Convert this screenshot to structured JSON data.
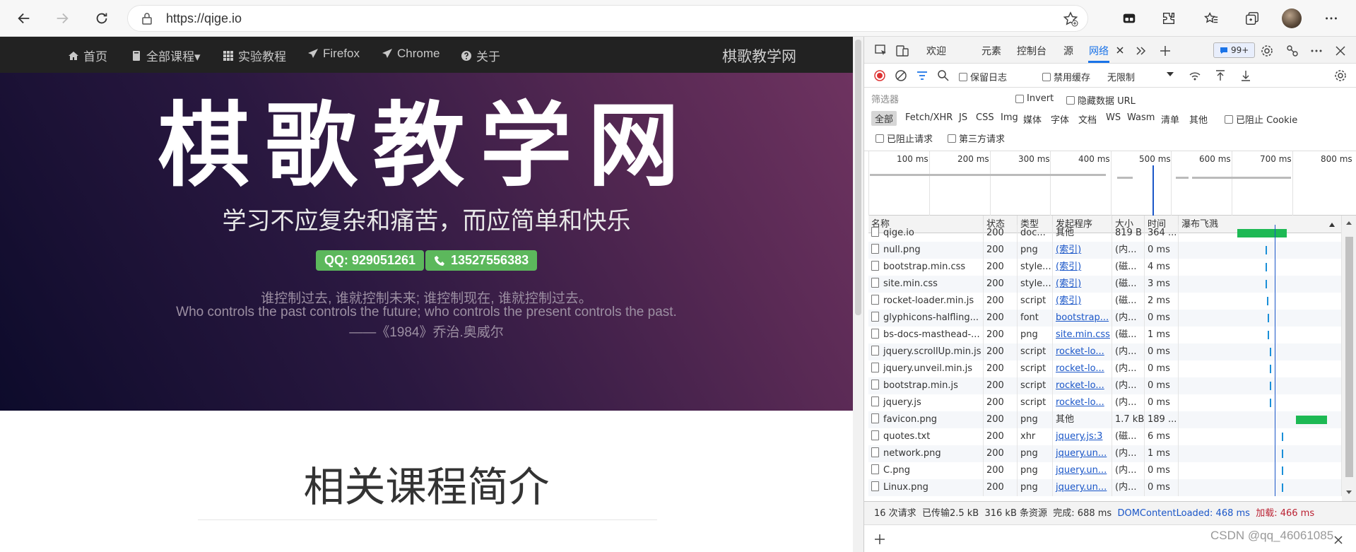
{
  "browser": {
    "url": "https://qige.io",
    "icons": [
      "back-icon",
      "forward-icon",
      "refresh-icon",
      "lock-icon",
      "add-favorite-icon",
      "collections-icon",
      "extensions-icon",
      "favorites-icon",
      "tab-actions-icon",
      "profile-avatar",
      "more-icon"
    ]
  },
  "site": {
    "nav": [
      {
        "label": "首页",
        "icon": "home-icon"
      },
      {
        "label": "全部课程▾",
        "icon": "book-icon"
      },
      {
        "label": "实验教程",
        "icon": "grid-icon"
      },
      {
        "label": "Firefox",
        "icon": "send-icon"
      },
      {
        "label": "Chrome",
        "icon": "send-icon"
      },
      {
        "label": "关于",
        "icon": "question-icon"
      }
    ],
    "brand": "棋歌教学网",
    "hero_title": "棋歌教学网",
    "hero_subtitle": "学习不应复杂和痛苦，而应简单和快乐",
    "qq_badge": "QQ: 929051261",
    "phone_badge": "13527556383",
    "quote_cn": "谁控制过去, 谁就控制未来; 谁控制现在, 谁就控制过去。",
    "quote_en": "Who controls the past controls the future; who controls the present controls the past.",
    "quote_author": "——《1984》乔治.奥威尔",
    "section_title": "相关课程简介",
    "colors": {
      "navbar": "#222222",
      "badge": "#5cb85c",
      "hero_start": "#0d0b2b",
      "hero_end": "#6e3360"
    }
  },
  "devtools": {
    "tabs": [
      "欢迎",
      "元素",
      "控制台",
      "源",
      "网络"
    ],
    "active_tab": "网络",
    "issues_count": "99+",
    "toolbar": {
      "preserve_log": "保留日志",
      "disable_cache": "禁用缓存",
      "throttle": "无限制"
    },
    "filter": {
      "placeholder": "筛选器",
      "invert": "Invert",
      "hide_data_urls": "隐藏数据 URL",
      "types": [
        "全部",
        "Fetch/XHR",
        "JS",
        "CSS",
        "Img",
        "媒体",
        "字体",
        "文档",
        "WS",
        "Wasm",
        "清单",
        "其他"
      ],
      "blocked_cookies": "已阻止 Cookie",
      "blocked_requests": "已阻止请求",
      "third_party": "第三方请求"
    },
    "timeline_ticks": [
      "100 ms",
      "200 ms",
      "300 ms",
      "400 ms",
      "500 ms",
      "600 ms",
      "700 ms",
      "800 ms"
    ],
    "columns": [
      "名称",
      "状态",
      "类型",
      "发起程序",
      "大小",
      "时间",
      "瀑布飞溅"
    ],
    "rows": [
      {
        "name": "qige.io",
        "status": "200",
        "type": "doc...",
        "initiator": "其他",
        "size": "819 B",
        "time": "364 ...",
        "link": false,
        "wf": 0.72
      },
      {
        "name": "null.png",
        "status": "200",
        "type": "png",
        "initiator": "(索引)",
        "size": "(内...",
        "time": "0 ms",
        "link": true,
        "wf": 0.76
      },
      {
        "name": "bootstrap.min.css",
        "status": "200",
        "type": "style...",
        "initiator": "(索引)",
        "size": "(磁...",
        "time": "4 ms",
        "link": true,
        "wf": 0.76
      },
      {
        "name": "site.min.css",
        "status": "200",
        "type": "style...",
        "initiator": "(索引)",
        "size": "(磁...",
        "time": "3 ms",
        "link": true,
        "wf": 0.76
      },
      {
        "name": "rocket-loader.min.js",
        "status": "200",
        "type": "script",
        "initiator": "(索引)",
        "size": "(磁...",
        "time": "2 ms",
        "link": true,
        "wf": 0.77
      },
      {
        "name": "glyphicons-halfling...",
        "status": "200",
        "type": "font",
        "initiator": "bootstrap...",
        "size": "(内...",
        "time": "0 ms",
        "link": true,
        "wf": 0.78
      },
      {
        "name": "bs-docs-masthead-...",
        "status": "200",
        "type": "png",
        "initiator": "site.min.css",
        "size": "(磁...",
        "time": "1 ms",
        "link": true,
        "wf": 0.78
      },
      {
        "name": "jquery.scrollUp.min.js",
        "status": "200",
        "type": "script",
        "initiator": "rocket-lo...",
        "size": "(内...",
        "time": "0 ms",
        "link": true,
        "wf": 0.8
      },
      {
        "name": "jquery.unveil.min.js",
        "status": "200",
        "type": "script",
        "initiator": "rocket-lo...",
        "size": "(内...",
        "time": "0 ms",
        "link": true,
        "wf": 0.8
      },
      {
        "name": "bootstrap.min.js",
        "status": "200",
        "type": "script",
        "initiator": "rocket-lo...",
        "size": "(内...",
        "time": "0 ms",
        "link": true,
        "wf": 0.8
      },
      {
        "name": "jquery.js",
        "status": "200",
        "type": "script",
        "initiator": "rocket-lo...",
        "size": "(内...",
        "time": "0 ms",
        "link": true,
        "wf": 0.8
      },
      {
        "name": "favicon.png",
        "status": "200",
        "type": "png",
        "initiator": "其他",
        "size": "1.7 kB",
        "time": "189 ...",
        "link": false,
        "wf": 0.9
      },
      {
        "name": "quotes.txt",
        "status": "200",
        "type": "xhr",
        "initiator": "jquery.js:3",
        "size": "(磁...",
        "time": "6 ms",
        "link": true,
        "wf": 0.9
      },
      {
        "name": "network.png",
        "status": "200",
        "type": "png",
        "initiator": "jquery.un...",
        "size": "(内...",
        "time": "1 ms",
        "link": true,
        "wf": 0.9
      },
      {
        "name": "C.png",
        "status": "200",
        "type": "png",
        "initiator": "jquery.un...",
        "size": "(内...",
        "time": "0 ms",
        "link": true,
        "wf": 0.9
      },
      {
        "name": "Linux.png",
        "status": "200",
        "type": "png",
        "initiator": "jquery.un...",
        "size": "(内...",
        "time": "0 ms",
        "link": true,
        "wf": 0.9
      }
    ],
    "status": {
      "requests": "16 次请求",
      "transferred": "已传输2.5 kB",
      "resources": "316 kB 条资源",
      "finish": "完成: 688 ms",
      "dcl": "DOMContentLoaded: 468 ms",
      "load": "加载: 466 ms"
    }
  },
  "watermark": "CSDN @qq_46061085"
}
